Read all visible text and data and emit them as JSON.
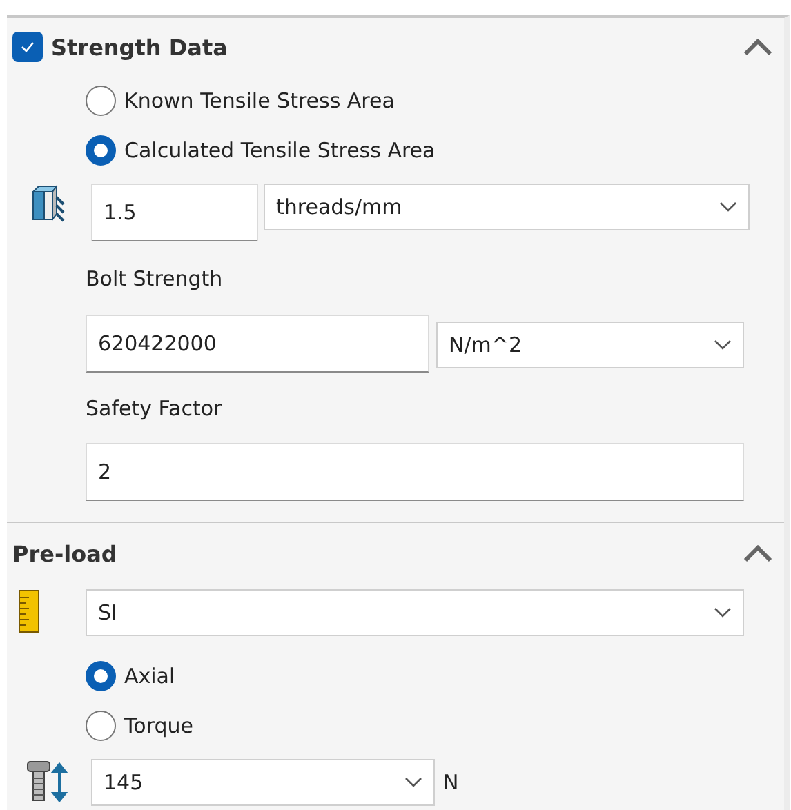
{
  "strength_data": {
    "title": "Strength Data",
    "checked": true,
    "expanded": true,
    "options": [
      {
        "label": "Known Tensile Stress Area",
        "selected": false
      },
      {
        "label": "Calculated Tensile Stress Area",
        "selected": true
      }
    ],
    "threads": {
      "value": "1.5",
      "unit": "threads/mm"
    },
    "bolt_strength": {
      "label": "Bolt Strength",
      "value": "620422000",
      "unit": "N/m^2"
    },
    "safety_factor": {
      "label": "Safety Factor",
      "value": "2"
    }
  },
  "pre_load": {
    "title": "Pre-load",
    "expanded": true,
    "unit_system": "SI",
    "options": [
      {
        "label": "Axial",
        "selected": true
      },
      {
        "label": "Torque",
        "selected": false
      }
    ],
    "value": "145",
    "unit": "N"
  }
}
